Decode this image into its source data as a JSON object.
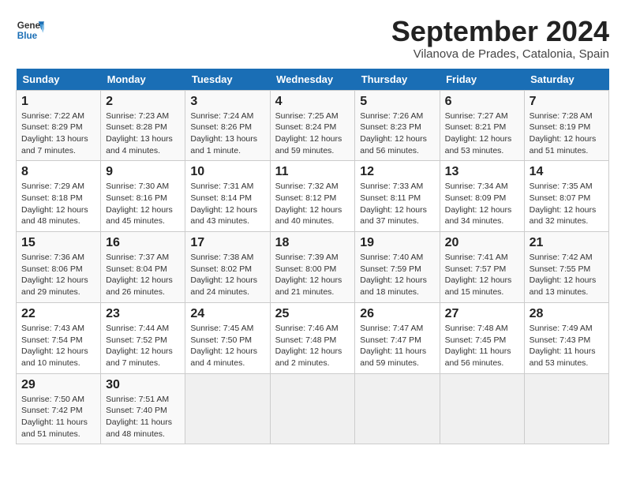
{
  "header": {
    "logo_line1": "General",
    "logo_line2": "Blue",
    "month": "September 2024",
    "location": "Vilanova de Prades, Catalonia, Spain"
  },
  "weekdays": [
    "Sunday",
    "Monday",
    "Tuesday",
    "Wednesday",
    "Thursday",
    "Friday",
    "Saturday"
  ],
  "weeks": [
    [
      {
        "day": "1",
        "info": "Sunrise: 7:22 AM\nSunset: 8:29 PM\nDaylight: 13 hours and 7 minutes."
      },
      {
        "day": "2",
        "info": "Sunrise: 7:23 AM\nSunset: 8:28 PM\nDaylight: 13 hours and 4 minutes."
      },
      {
        "day": "3",
        "info": "Sunrise: 7:24 AM\nSunset: 8:26 PM\nDaylight: 13 hours and 1 minute."
      },
      {
        "day": "4",
        "info": "Sunrise: 7:25 AM\nSunset: 8:24 PM\nDaylight: 12 hours and 59 minutes."
      },
      {
        "day": "5",
        "info": "Sunrise: 7:26 AM\nSunset: 8:23 PM\nDaylight: 12 hours and 56 minutes."
      },
      {
        "day": "6",
        "info": "Sunrise: 7:27 AM\nSunset: 8:21 PM\nDaylight: 12 hours and 53 minutes."
      },
      {
        "day": "7",
        "info": "Sunrise: 7:28 AM\nSunset: 8:19 PM\nDaylight: 12 hours and 51 minutes."
      }
    ],
    [
      {
        "day": "8",
        "info": "Sunrise: 7:29 AM\nSunset: 8:18 PM\nDaylight: 12 hours and 48 minutes."
      },
      {
        "day": "9",
        "info": "Sunrise: 7:30 AM\nSunset: 8:16 PM\nDaylight: 12 hours and 45 minutes."
      },
      {
        "day": "10",
        "info": "Sunrise: 7:31 AM\nSunset: 8:14 PM\nDaylight: 12 hours and 43 minutes."
      },
      {
        "day": "11",
        "info": "Sunrise: 7:32 AM\nSunset: 8:12 PM\nDaylight: 12 hours and 40 minutes."
      },
      {
        "day": "12",
        "info": "Sunrise: 7:33 AM\nSunset: 8:11 PM\nDaylight: 12 hours and 37 minutes."
      },
      {
        "day": "13",
        "info": "Sunrise: 7:34 AM\nSunset: 8:09 PM\nDaylight: 12 hours and 34 minutes."
      },
      {
        "day": "14",
        "info": "Sunrise: 7:35 AM\nSunset: 8:07 PM\nDaylight: 12 hours and 32 minutes."
      }
    ],
    [
      {
        "day": "15",
        "info": "Sunrise: 7:36 AM\nSunset: 8:06 PM\nDaylight: 12 hours and 29 minutes."
      },
      {
        "day": "16",
        "info": "Sunrise: 7:37 AM\nSunset: 8:04 PM\nDaylight: 12 hours and 26 minutes."
      },
      {
        "day": "17",
        "info": "Sunrise: 7:38 AM\nSunset: 8:02 PM\nDaylight: 12 hours and 24 minutes."
      },
      {
        "day": "18",
        "info": "Sunrise: 7:39 AM\nSunset: 8:00 PM\nDaylight: 12 hours and 21 minutes."
      },
      {
        "day": "19",
        "info": "Sunrise: 7:40 AM\nSunset: 7:59 PM\nDaylight: 12 hours and 18 minutes."
      },
      {
        "day": "20",
        "info": "Sunrise: 7:41 AM\nSunset: 7:57 PM\nDaylight: 12 hours and 15 minutes."
      },
      {
        "day": "21",
        "info": "Sunrise: 7:42 AM\nSunset: 7:55 PM\nDaylight: 12 hours and 13 minutes."
      }
    ],
    [
      {
        "day": "22",
        "info": "Sunrise: 7:43 AM\nSunset: 7:54 PM\nDaylight: 12 hours and 10 minutes."
      },
      {
        "day": "23",
        "info": "Sunrise: 7:44 AM\nSunset: 7:52 PM\nDaylight: 12 hours and 7 minutes."
      },
      {
        "day": "24",
        "info": "Sunrise: 7:45 AM\nSunset: 7:50 PM\nDaylight: 12 hours and 4 minutes."
      },
      {
        "day": "25",
        "info": "Sunrise: 7:46 AM\nSunset: 7:48 PM\nDaylight: 12 hours and 2 minutes."
      },
      {
        "day": "26",
        "info": "Sunrise: 7:47 AM\nSunset: 7:47 PM\nDaylight: 11 hours and 59 minutes."
      },
      {
        "day": "27",
        "info": "Sunrise: 7:48 AM\nSunset: 7:45 PM\nDaylight: 11 hours and 56 minutes."
      },
      {
        "day": "28",
        "info": "Sunrise: 7:49 AM\nSunset: 7:43 PM\nDaylight: 11 hours and 53 minutes."
      }
    ],
    [
      {
        "day": "29",
        "info": "Sunrise: 7:50 AM\nSunset: 7:42 PM\nDaylight: 11 hours and 51 minutes."
      },
      {
        "day": "30",
        "info": "Sunrise: 7:51 AM\nSunset: 7:40 PM\nDaylight: 11 hours and 48 minutes."
      },
      {
        "day": "",
        "info": ""
      },
      {
        "day": "",
        "info": ""
      },
      {
        "day": "",
        "info": ""
      },
      {
        "day": "",
        "info": ""
      },
      {
        "day": "",
        "info": ""
      }
    ]
  ]
}
